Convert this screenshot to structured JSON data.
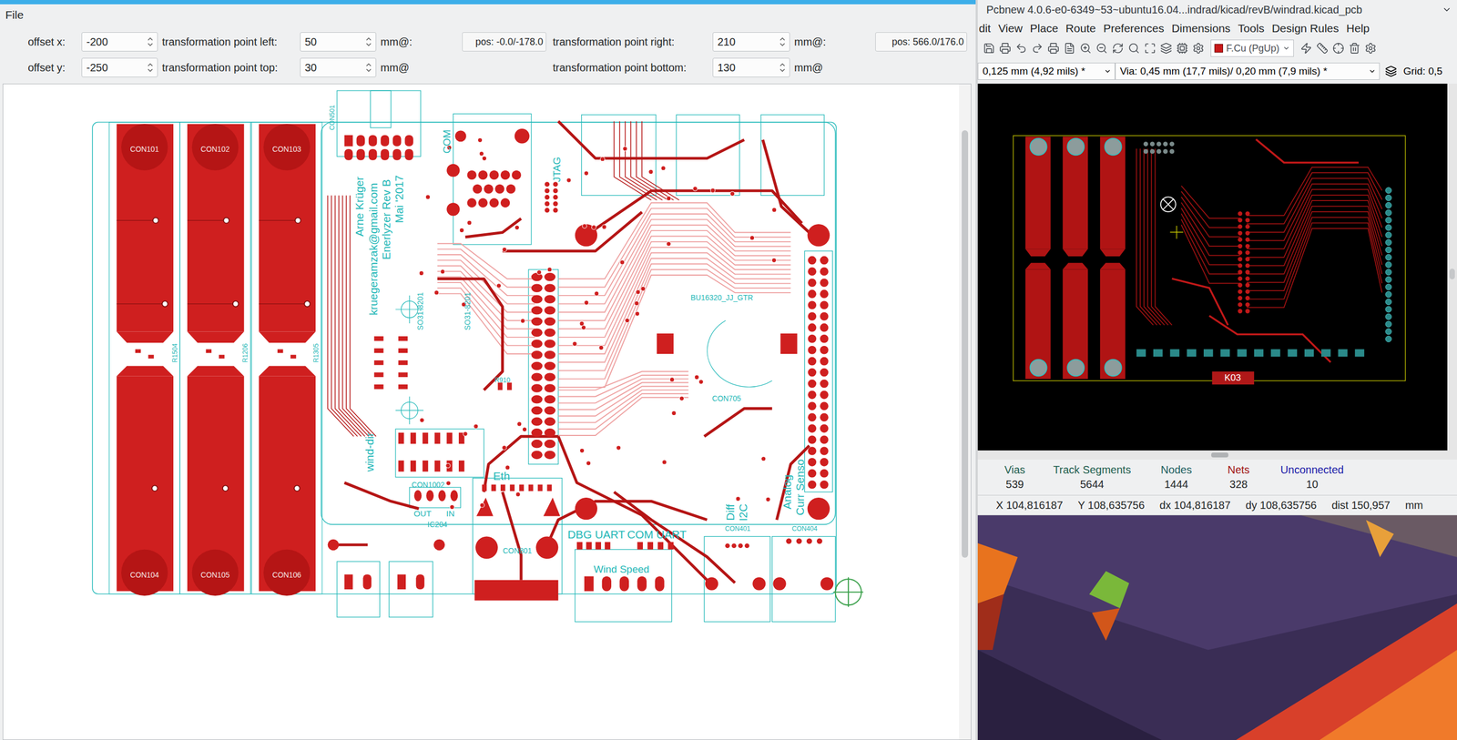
{
  "left_window": {
    "menu": [
      "File"
    ],
    "transform_rows": [
      {
        "offset_label": "offset x:",
        "offset_value": "-200",
        "first_label": "transformation point left:",
        "first_value": "50",
        "first_unit": "mm@:",
        "first_pos": "pos: -0.0/-178.0",
        "second_label": "transformation point right:",
        "second_value": "210",
        "second_unit": "mm@:",
        "second_pos": "pos: 566.0/176.0"
      },
      {
        "offset_label": "offset y:",
        "offset_value": "-250",
        "first_label": "transformation point top:",
        "first_value": "30",
        "first_unit": "mm@",
        "second_label": "transformation point bottom:",
        "second_value": "130",
        "second_unit": "mm@"
      }
    ],
    "pcb_labels": [
      "CON101",
      "CON102",
      "CON103",
      "CON104",
      "CON105",
      "CON106",
      "R1504",
      "R1206",
      "R1305",
      "CON501",
      "COM",
      "JTAG",
      "Arne Krüger",
      "kruegeramzak@gmail.com",
      "Enerlyzer Rev B",
      "Mai '2017",
      "SO31-8201",
      "SO31-8201",
      "R910",
      "BU16320_JJ_GTR",
      "CON705",
      "wind-dir",
      "CON1002",
      "OUT",
      "IN",
      "IC204",
      "Eth",
      "CON801",
      "DBG UART",
      "COM UART",
      "Wind Speed",
      "Diff",
      "I2C",
      "Analog",
      "Curr Senso",
      "CON401",
      "CON404"
    ]
  },
  "pcbnew": {
    "title": "Pcbnew 4.0.6-e0-6349~53~ubuntu16.04...indrad/kicad/revB/windrad.kicad_pcb",
    "menu": [
      "dit",
      "View",
      "Place",
      "Route",
      "Preferences",
      "Dimensions",
      "Tools",
      "Design Rules",
      "Help"
    ],
    "layer": {
      "label": "F.Cu (PgUp)",
      "color": "#c81818"
    },
    "track_width": "0,125 mm (4,92 mils) *",
    "via_size": "Via: 0,45 mm (17,7 mils)/ 0,20 mm (7,9 mils) *",
    "grid": "Grid: 0,5",
    "board_labels": [
      "K03"
    ],
    "stats": [
      {
        "label": "Vias",
        "value": "539",
        "color": "#1e5e4e"
      },
      {
        "label": "Track Segments",
        "value": "5644",
        "color": "#1e5e4e"
      },
      {
        "label": "Nodes",
        "value": "1444",
        "color": "#1c5e5e"
      },
      {
        "label": "Nets",
        "value": "328",
        "color": "#a01010"
      },
      {
        "label": "Unconnected",
        "value": "10",
        "color": "#1a1aa8"
      }
    ],
    "coordinates": [
      "X 104,816187",
      "Y 108,635756",
      "dx 104,816187",
      "dy 108,635756",
      "dist 150,957"
    ],
    "units": "mm"
  }
}
